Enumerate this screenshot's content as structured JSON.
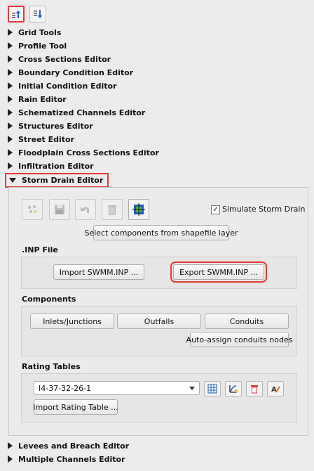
{
  "toolbar": {
    "collapse_all_icon": "collapse-up-icon",
    "expand_all_icon": "expand-down-icon"
  },
  "sections": [
    {
      "label": "Grid Tools"
    },
    {
      "label": "Profile Tool"
    },
    {
      "label": "Cross Sections Editor"
    },
    {
      "label": "Boundary Condition Editor"
    },
    {
      "label": "Initial Condition Editor"
    },
    {
      "label": "Rain Editor"
    },
    {
      "label": "Schematized Channels Editor"
    },
    {
      "label": "Structures Editor"
    },
    {
      "label": "Street Editor"
    },
    {
      "label": "Floodplain Cross Sections Editor"
    },
    {
      "label": "Infiltration Editor"
    }
  ],
  "storm_drain": {
    "header": "Storm Drain Editor",
    "simulate_label": "Simulate Storm Drain",
    "simulate_checked": true,
    "select_components_btn": "Select components from shapefile layer",
    "inp_label": ".INP File",
    "import_inp_btn": "Import SWMM.INP ...",
    "export_inp_btn": "Export SWMM.INP ...",
    "components_label": "Components",
    "inlets_btn": "Inlets/Junctions",
    "outfalls_btn": "Outfalls",
    "conduits_btn": "Conduits",
    "auto_assign_btn": "Auto-assign conduits nodes",
    "rating_label": "Rating Tables",
    "rating_selected": "I4-37-32-26-1",
    "import_rating_btn": "Import Rating Table ..."
  },
  "bottom_sections": [
    {
      "label": "Levees and Breach Editor"
    },
    {
      "label": "Multiple Channels Editor"
    }
  ],
  "colors": {
    "highlight": "#e53935",
    "accent": "#1e5fb4"
  }
}
